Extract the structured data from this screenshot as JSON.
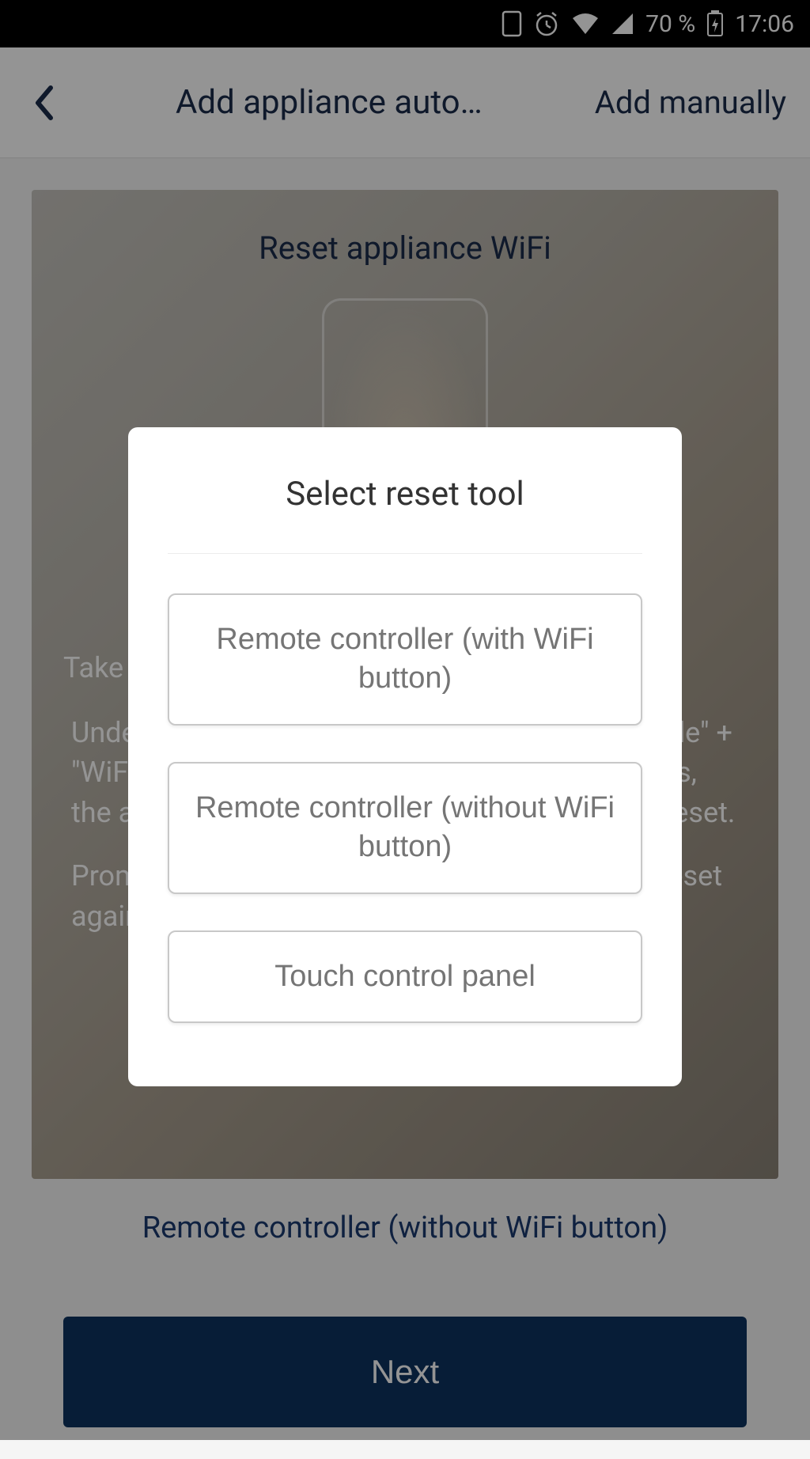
{
  "statusBar": {
    "battery": "70 %",
    "time": "17:06"
  },
  "header": {
    "title": "Add appliance auto…",
    "addManually": "Add manually"
  },
  "card": {
    "title": "Reset appliance WiFi",
    "instructionMain": "Take out the remote controller of this appliance",
    "instructionDetail": "Under the power-on state, hold on pressing \"Mode\" + \"WiFi\" buttons for 3 seconds. After hearing beeps, the appliance WiFi module will be successfully reset.",
    "instructionPrompt": "Prompt: If you already reset once, please don't reset again.",
    "resetToolLink": "Remote controller (without WiFi button)",
    "nextButton": "Next"
  },
  "modal": {
    "title": "Select reset tool",
    "options": [
      "Remote controller (with WiFi button)",
      "Remote controller (without WiFi button)",
      "Touch control panel"
    ]
  }
}
